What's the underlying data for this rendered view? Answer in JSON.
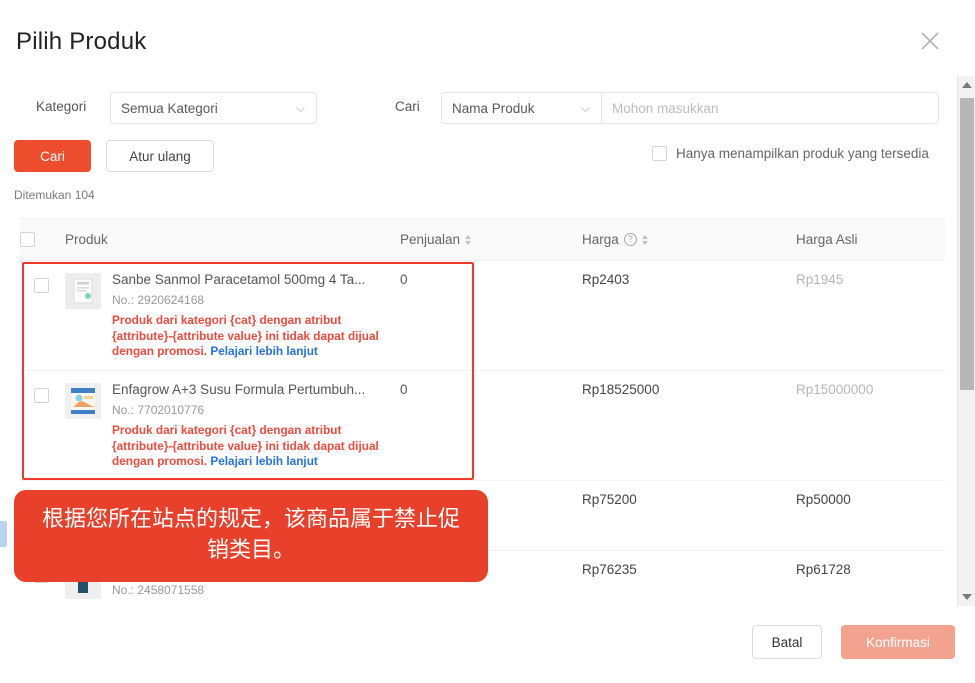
{
  "dialog": {
    "title": "Pilih Produk",
    "close_icon": "close-icon"
  },
  "filters": {
    "kategori_label": "Kategori",
    "kategori_value": "Semua Kategori",
    "cari_label": "Cari",
    "cari_field_value": "Nama Produk",
    "search_placeholder": "Mohon masukkan",
    "search_value": "",
    "search_button": "Cari",
    "reset_button": "Atur ulang",
    "available_only_label": "Hanya menampilkan produk yang tersedia",
    "found_text": "Ditemukan 104"
  },
  "table": {
    "headers": {
      "produk": "Produk",
      "penjualan": "Penjualan",
      "harga": "Harga",
      "harga_asli": "Harga Asli"
    },
    "rows": [
      {
        "name": "Sanbe Sanmol Paracetamol 500mg 4 Ta...",
        "sku": "No.: 2920624168",
        "warning": "Produk dari kategori {cat} dengan atribut {attribute}-{attribute value} ini tidak dapat dijual dengan promosi.",
        "warning_link": "Pelajari lebih lanjut",
        "sales": "0",
        "price": "Rp2403",
        "original_price": "Rp1945"
      },
      {
        "name": "Enfagrow A+3 Susu Formula Pertumbuh...",
        "sku": "No.: 7702010776",
        "warning": "Produk dari kategori {cat} dengan atribut {attribute}-{attribute value} ini tidak dapat dijual dengan promosi.",
        "warning_link": "Pelajari lebih lanjut",
        "sales": "0",
        "price": "Rp18525000",
        "original_price": "Rp15000000"
      },
      {
        "name": "",
        "sku": "",
        "warning": "",
        "warning_link": "",
        "sales": "",
        "price": "Rp75200",
        "original_price": "Rp50000"
      },
      {
        "name": "",
        "sku": "No.: 2458071558",
        "warning": "",
        "warning_link": "",
        "sales": "",
        "price": "Rp76235",
        "original_price": "Rp61728"
      }
    ]
  },
  "tooltip": {
    "text": "根据您所在站点的规定，该商品属于禁止促销类目。"
  },
  "footer": {
    "cancel": "Batal",
    "confirm": "Konfirmasi"
  },
  "colors": {
    "brand": "#ee4d2d",
    "warning_red": "#ef4b3c",
    "tooltip_bg": "#e8402a",
    "link_blue": "#2673dd",
    "outline_red": "#f0392b"
  }
}
